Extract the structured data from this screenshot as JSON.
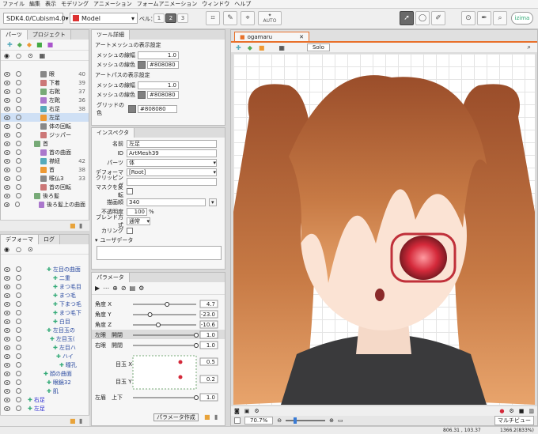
{
  "menu": [
    "ファイル",
    "編集",
    "表示",
    "モデリング",
    "アニメーション",
    "フォームアニメーション",
    "ウィンドウ",
    "ヘルプ"
  ],
  "toolbar": {
    "sdk_select": "SDK4.0/Cubism4.0",
    "model_select": "Model",
    "level_label": "ベル：",
    "levels": [
      "1",
      "2",
      "3"
    ],
    "auto_label": "AUTO",
    "logo_text": "izima"
  },
  "parts_panel": {
    "tabs": [
      "パーツ",
      "プロジェクト"
    ],
    "rows": [
      {
        "label": "眼",
        "num": "40"
      },
      {
        "label": "下着",
        "num": "39"
      },
      {
        "label": "右靴",
        "num": "37"
      },
      {
        "label": "左靴",
        "num": "36"
      },
      {
        "label": "右足",
        "num": "38"
      },
      {
        "label": "左足",
        "num": ""
      },
      {
        "label": "体の回転",
        "num": ""
      },
      {
        "label": "ジッパー",
        "num": ""
      },
      {
        "label": "首",
        "num": ""
      },
      {
        "label": "首の曲面",
        "num": ""
      },
      {
        "label": "襟紐",
        "num": "42"
      },
      {
        "label": "首",
        "num": "38"
      },
      {
        "label": "喉仏3",
        "num": "33"
      },
      {
        "label": "首の回転",
        "num": ""
      },
      {
        "label": "後ろ髪",
        "num": ""
      },
      {
        "label": "後ろ髪上の曲面",
        "num": ""
      }
    ]
  },
  "deformer_panel": {
    "tabs": [
      "デフォーマ",
      "ログ"
    ],
    "rows": [
      {
        "label": "左目の曲面",
        "indent": 8
      },
      {
        "label": "二重",
        "indent": 10
      },
      {
        "label": "まつ毛目",
        "indent": 10
      },
      {
        "label": "まつ毛",
        "indent": 10
      },
      {
        "label": "下まつ毛",
        "indent": 10
      },
      {
        "label": "まつ毛下",
        "indent": 10
      },
      {
        "label": "白目",
        "indent": 10
      },
      {
        "label": "左目玉の",
        "indent": 8
      },
      {
        "label": "左目玉(",
        "indent": 9
      },
      {
        "label": "左目ハ",
        "indent": 10
      },
      {
        "label": "ハイ",
        "indent": 11
      },
      {
        "label": "瞳孔",
        "indent": 12
      },
      {
        "label": "顔の曲面",
        "indent": 7
      },
      {
        "label": "眼鏡32",
        "indent": 8
      },
      {
        "label": "肌",
        "indent": 8
      },
      {
        "label": "右足",
        "indent": 2
      },
      {
        "label": "左足",
        "indent": 2
      }
    ]
  },
  "tool_details": {
    "title": "ツール詳細",
    "section1": "アートメッシュの表示設定",
    "section2": "アートパスの表示設定",
    "rows1": [
      {
        "label": "メッシュの線幅",
        "value": "1.0"
      },
      {
        "label": "メッシュの線色",
        "value": "#808080"
      }
    ],
    "rows2": [
      {
        "label": "メッシュの線幅",
        "value": "1.0"
      },
      {
        "label": "メッシュの線色",
        "value": "#808080"
      }
    ],
    "grid_label": "グリッドの色",
    "grid_value": "#808080"
  },
  "inspector": {
    "title": "インスペクタ",
    "name_label": "名前",
    "name_value": "左足",
    "id_label": "ID",
    "id_value": "ArtMesh39",
    "part_label": "パーツ",
    "part_value": "体",
    "deformer_label": "デフォーマ",
    "deformer_value": "[Root]",
    "clipping_label": "クリッピング",
    "clipping_value": "",
    "invert_label": "マスクを反転",
    "draw_order_label": "描画順",
    "draw_order_value": "340",
    "opacity_label": "不透明度",
    "opacity_value": "100",
    "opacity_unit": "%",
    "blend_label": "ブレンド方式",
    "blend_value": "通常",
    "culling_label": "カリング",
    "userdata_label": "ユーザデータ"
  },
  "parameters": {
    "title": "パラメータ",
    "rows": [
      {
        "label": "角度 X",
        "value": "4.7",
        "level": 0.54
      },
      {
        "label": "角度 Y",
        "value": "-23.0",
        "level": 0.27
      },
      {
        "label": "角度 Z",
        "value": "-10.6",
        "level": 0.4
      },
      {
        "label": "左眼　開閉",
        "value": "1.0",
        "level": 1.0
      },
      {
        "label": "右眼　開閉",
        "value": "1.0",
        "level": 1.0
      }
    ],
    "eyeball_x_label": "目玉 X",
    "eyeball_x_value": "0.5",
    "eyeball_y_label": "目玉 Y",
    "eyeball_y_value": "0.2",
    "last_row_label": "左眉　上下",
    "last_row_value": "1.0",
    "create_button": "パラメータ作成"
  },
  "viewer": {
    "tab_title": "ogamaru",
    "solo_label": "Solo",
    "zoom": "70.7%",
    "multiview_label": "マルチビュー"
  },
  "status": {
    "coords": "806.31 , 103.37",
    "right": "1366.2(833%)"
  },
  "colors": {
    "accent_orange": "#e8702a",
    "hair": "#b4653a",
    "eye_red": "#d4293a"
  }
}
